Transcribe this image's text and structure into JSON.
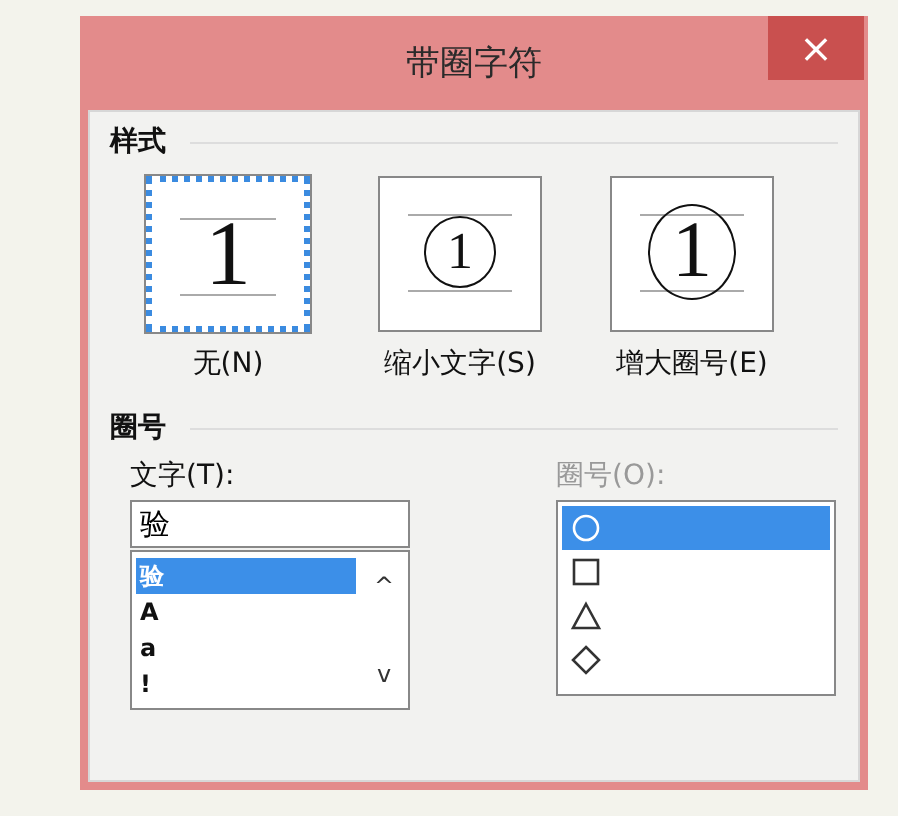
{
  "window": {
    "title": "带圈字符",
    "close": "×"
  },
  "style_section": {
    "heading": "样式",
    "options": [
      {
        "kind": "none",
        "preview": "1",
        "label": "无(N)",
        "selected": true
      },
      {
        "kind": "shrink",
        "preview": "1",
        "label": "缩小文字(S)",
        "selected": false
      },
      {
        "kind": "enlarge",
        "preview": "1",
        "label": "增大圈号(E)",
        "selected": false
      }
    ]
  },
  "enclosure_section": {
    "heading": "圈号",
    "text": {
      "label": "文字(T):",
      "value": "验",
      "items": [
        {
          "label": "验",
          "selected": true
        },
        {
          "label": "A",
          "selected": false
        },
        {
          "label": "a",
          "selected": false
        },
        {
          "label": "!",
          "selected": false
        }
      ],
      "scroll_up": "^",
      "scroll_down": "v"
    },
    "enclosure": {
      "label": "圈号(O):",
      "disabled": true,
      "items": [
        {
          "kind": "circle",
          "selected": true
        },
        {
          "kind": "square",
          "selected": false
        },
        {
          "kind": "triangle",
          "selected": false
        },
        {
          "kind": "diamond",
          "selected": false
        }
      ]
    }
  }
}
